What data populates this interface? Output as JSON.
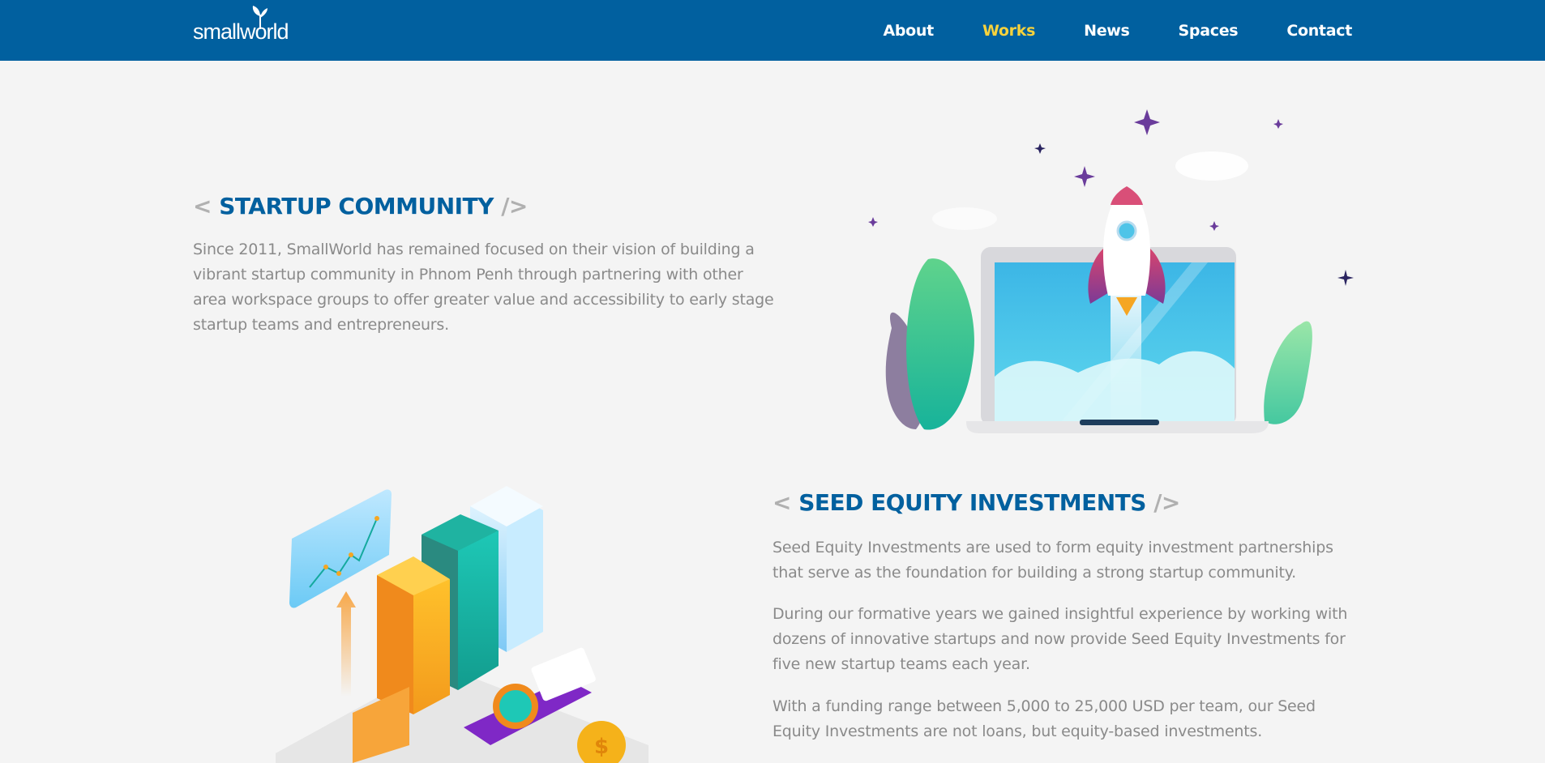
{
  "brand": {
    "logo_text": "smallworld"
  },
  "nav": {
    "items": [
      {
        "label": "About",
        "active": false
      },
      {
        "label": "Works",
        "active": true
      },
      {
        "label": "News",
        "active": false
      },
      {
        "label": "Spaces",
        "active": false
      },
      {
        "label": "Contact",
        "active": false
      }
    ]
  },
  "colors": {
    "header": "#01609f",
    "active_nav": "#f7d23c",
    "title": "#01609f",
    "body_text": "#8a8a8a",
    "bracket": "#b0b0b0"
  },
  "section1": {
    "open_bracket": "<",
    "title": "STARTUP COMMUNITY",
    "close_bracket": "/>",
    "paragraphs": [
      "Since 2011, SmallWorld has remained focused on their vision of building a vibrant startup community in Phnom Penh through partnering with other area workspace groups to offer greater value and accessibility to early stage startup teams and entrepreneurs."
    ],
    "illustration": "rocket-laptop-illustration"
  },
  "section2": {
    "open_bracket": "<",
    "title": "SEED EQUITY INVESTMENTS",
    "close_bracket": "/>",
    "paragraphs": [
      "Seed Equity Investments are used to form equity investment partnerships that serve as the foundation for building a strong startup community.",
      "During our formative years we gained insightful experience by working with dozens of innovative startups and now provide Seed Equity Investments for five new startup teams each year.",
      "With a funding range between 5,000 to 25,000 USD per team, our Seed Equity Investments are not loans, but equity-based investments."
    ],
    "illustration": "growth-chart-illustration"
  }
}
